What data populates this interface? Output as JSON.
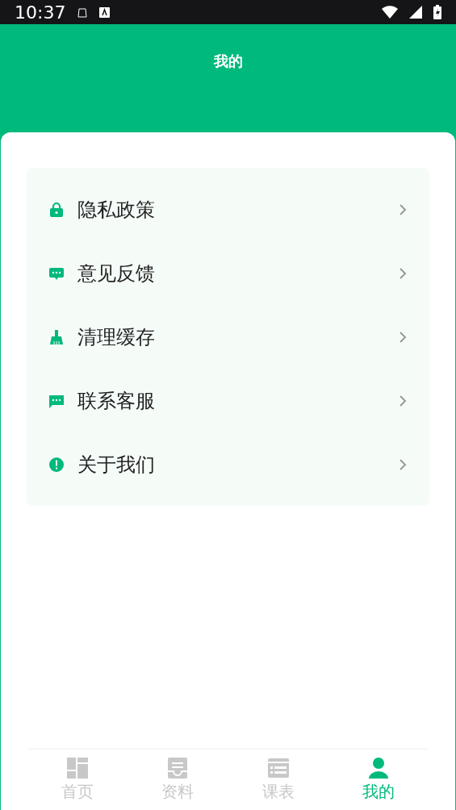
{
  "status_bar": {
    "time": "10:37"
  },
  "header": {
    "title": "我的"
  },
  "menu": [
    {
      "label": "隐私政策",
      "kind": "lock"
    },
    {
      "label": "意见反馈",
      "kind": "feedback"
    },
    {
      "label": "清理缓存",
      "kind": "broom"
    },
    {
      "label": "联系客服",
      "kind": "message"
    },
    {
      "label": "关于我们",
      "kind": "info"
    }
  ],
  "tabs": [
    {
      "label": "首页",
      "kind": "home",
      "selected": false
    },
    {
      "label": "资料",
      "kind": "docs",
      "selected": false
    },
    {
      "label": "课表",
      "kind": "schedule",
      "selected": false
    },
    {
      "label": "我的",
      "kind": "me",
      "selected": true
    }
  ]
}
